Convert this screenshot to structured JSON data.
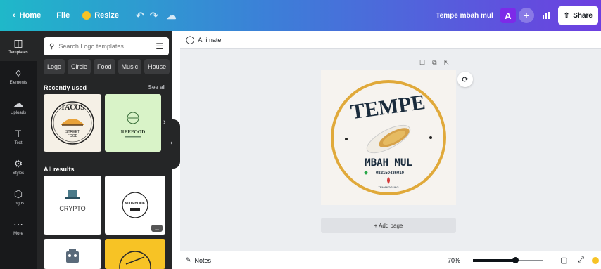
{
  "topbar": {
    "home_label": "Home",
    "file_label": "File",
    "resize_label": "Resize",
    "doc_title": "Tempe mbah mul",
    "avatar_letter": "A",
    "share_label": "Share",
    "gradient_colors": [
      "#1fb8c9",
      "#3c7fd8",
      "#6d3fe0"
    ]
  },
  "rail": {
    "items": [
      {
        "label": "Templates",
        "icon": "template-icon"
      },
      {
        "label": "Elements",
        "icon": "elements-icon"
      },
      {
        "label": "Uploads",
        "icon": "upload-icon"
      },
      {
        "label": "Text",
        "icon": "text-icon"
      },
      {
        "label": "Styles",
        "icon": "styles-icon"
      },
      {
        "label": "Logos",
        "icon": "logos-icon"
      },
      {
        "label": "More",
        "icon": "more-icon"
      }
    ]
  },
  "panel": {
    "search_placeholder": "Search Logo templates",
    "chips": [
      "Logo",
      "Circle",
      "Food",
      "Music",
      "House"
    ],
    "recently_used": "Recently used",
    "see_all": "See all",
    "all_results": "All results",
    "thumbs": {
      "tacos_title": "TACOS",
      "tacos_sub1": "STREET",
      "tacos_sub2": "FOOD",
      "reefood": "REEFOOD",
      "crypto": "CRYPTO",
      "notebook": "NOTEBOOK",
      "crypto_badge": "..."
    }
  },
  "canvas": {
    "animate_label": "Animate",
    "logo_title": "TEMPE",
    "logo_name": "MBAH MUL",
    "logo_phone": "082150436010",
    "logo_location": "TEMANGGUNG",
    "add_page_label": "+ Add page",
    "logo_ring_color": "#e0a93a"
  },
  "bottom": {
    "notes_label": "Notes",
    "zoom_label": "70%",
    "zoom_fraction": 0.6
  }
}
